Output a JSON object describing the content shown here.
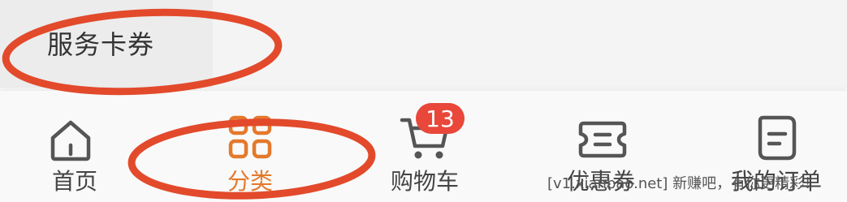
{
  "top": {
    "service_label": "服务卡券"
  },
  "tabs": [
    {
      "label": "首页",
      "icon": "home-icon"
    },
    {
      "label": "分类",
      "icon": "category-grid-icon",
      "active": true
    },
    {
      "label": "购物车",
      "icon": "cart-icon",
      "badge": "13"
    },
    {
      "label": "优惠券",
      "icon": "coupon-icon"
    },
    {
      "label": "我的订单",
      "icon": "order-document-icon"
    }
  ],
  "colors": {
    "accent": "#e4792b",
    "badge": "#e8473a",
    "annotation": "#e24a2b",
    "icon": "#555555"
  },
  "watermark": "[v1.xianbao.net] 新赚吧，有你更精彩！"
}
